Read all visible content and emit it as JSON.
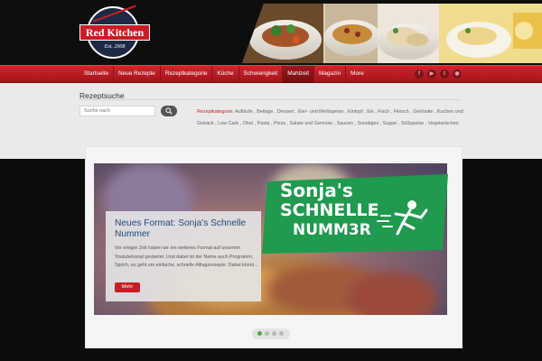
{
  "header": {
    "logo": {
      "name": "Red Kitchen",
      "est": "Est. 2008"
    }
  },
  "nav": {
    "items": [
      {
        "label": "Startseite",
        "active": false
      },
      {
        "label": "Neue Rezepte",
        "active": false
      },
      {
        "label": "Rezeptkategorie",
        "active": false
      },
      {
        "label": "Küche",
        "active": false
      },
      {
        "label": "Schwierigkeit",
        "active": false
      },
      {
        "label": "Mahlzeit",
        "active": true
      },
      {
        "label": "Magazin",
        "active": false
      },
      {
        "label": "More",
        "active": false
      }
    ],
    "social": [
      "facebook-icon",
      "youtube-icon",
      "twitter-icon",
      "rss-icon"
    ]
  },
  "search": {
    "title": "Rezeptsuche",
    "placeholder": "Suche nach",
    "category_label": "Rezeptkategorie:",
    "categories": [
      "Aufläufe",
      "Beilage",
      "Dessert",
      "Eier- und Mehlspeise",
      "Eintopf",
      "Eis",
      "Fisch",
      "Fleisch",
      "Getränke",
      "Kuchen und Gebäck",
      "Low Carb",
      "Obst",
      "Pasta",
      "Pizza",
      "Salate und Gemüse",
      "Saucen",
      "Sonstiges",
      "Suppe",
      "Süßspeise",
      "Vegetarisches"
    ]
  },
  "slider": {
    "caption_title": "Neues Format: Sonja's Schnelle Nummer",
    "caption_text": "Vor einiger Zeit haben wir ein weiteres Format auf unserem Youtubekanal gestartet. Und dabei ist der Name auch Programm. Sprich, es geht um einfache, schnelle Alltagsrezepte. Dabei könnt...",
    "button_label": "Mehr",
    "promo_lines": [
      "Sonja's",
      "SCHNELLE",
      "NUMM3R"
    ],
    "dots": 4,
    "active_dot": 0
  },
  "colors": {
    "brand_red": "#c81d25",
    "promo_green": "#1f9a4e",
    "link_blue": "#1c4a7a"
  }
}
